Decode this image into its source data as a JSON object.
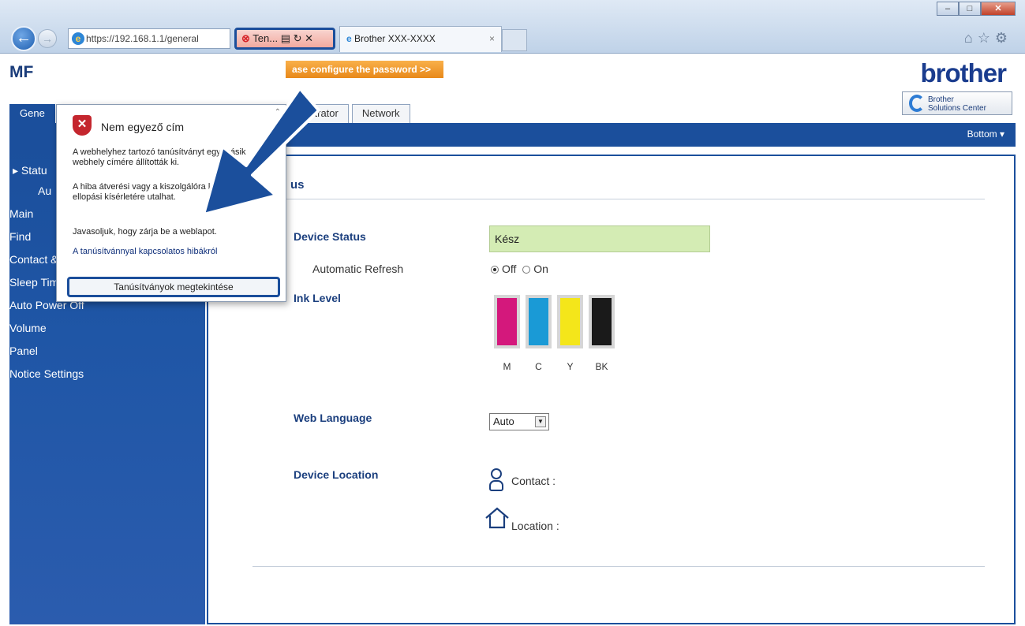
{
  "browser": {
    "address": "https://192.168.1.1/general",
    "cert_tab_label": "Ten...",
    "tab_title": "Brother XXX-XXXX",
    "tab_close": "×",
    "win_min": "–",
    "win_max": "□",
    "win_close": "✕"
  },
  "header": {
    "model_title": "MF",
    "password_banner": "ase configure the password >>",
    "logo": "brother",
    "solutions_center": "Brother\nSolutions Center"
  },
  "tabs": {
    "general": "Gene",
    "administrator": "inistrator",
    "network": "Network"
  },
  "bottom_link": "Bottom ▾",
  "sidebar": {
    "items": [
      {
        "label": "▸ Statu"
      },
      {
        "label": "Au"
      },
      {
        "label": "Main"
      },
      {
        "label": "Find"
      },
      {
        "label": "Contact & Location"
      },
      {
        "label": "Sleep Time"
      },
      {
        "label": "Auto Power Off"
      },
      {
        "label": "Volume"
      },
      {
        "label": "Panel"
      },
      {
        "label": "Notice Settings"
      }
    ]
  },
  "main": {
    "section_title": "us",
    "device_status_label": "Device Status",
    "device_status_value": "Kész",
    "auto_refresh_label": "Automatic Refresh",
    "refresh_off": "Off",
    "refresh_on": "On",
    "ink_level_label": "Ink Level",
    "inks": [
      {
        "label": "M",
        "color": "#d4187c",
        "level": 1.0
      },
      {
        "label": "C",
        "color": "#1a9ad6",
        "level": 1.0
      },
      {
        "label": "Y",
        "color": "#f4e61a",
        "level": 1.0
      },
      {
        "label": "BK",
        "color": "#1a1a1a",
        "level": 1.0
      }
    ],
    "web_language_label": "Web Language",
    "web_language_value": "Auto",
    "device_location_label": "Device Location",
    "contact_label": "Contact :",
    "location_label": "Location :"
  },
  "popup": {
    "title": "Nem egyező cím",
    "text1": "A webhelyhez tartozó tanúsítványt egy másik webhely címére állították ki.",
    "text2": "A hiba átverési vagy a kiszolgálóra küldött adatok ellopási kísérletére utalhat.",
    "text3": "Javasoljuk, hogy zárja be a weblapot.",
    "link": "A tanúsítvánnyal kapcsolatos hibákról",
    "button": "Tanúsítványok megtekintése"
  },
  "colors": {
    "accent": "#1b4f9c",
    "status_ok": "#d4ecb4",
    "warning": "#c4262e"
  }
}
